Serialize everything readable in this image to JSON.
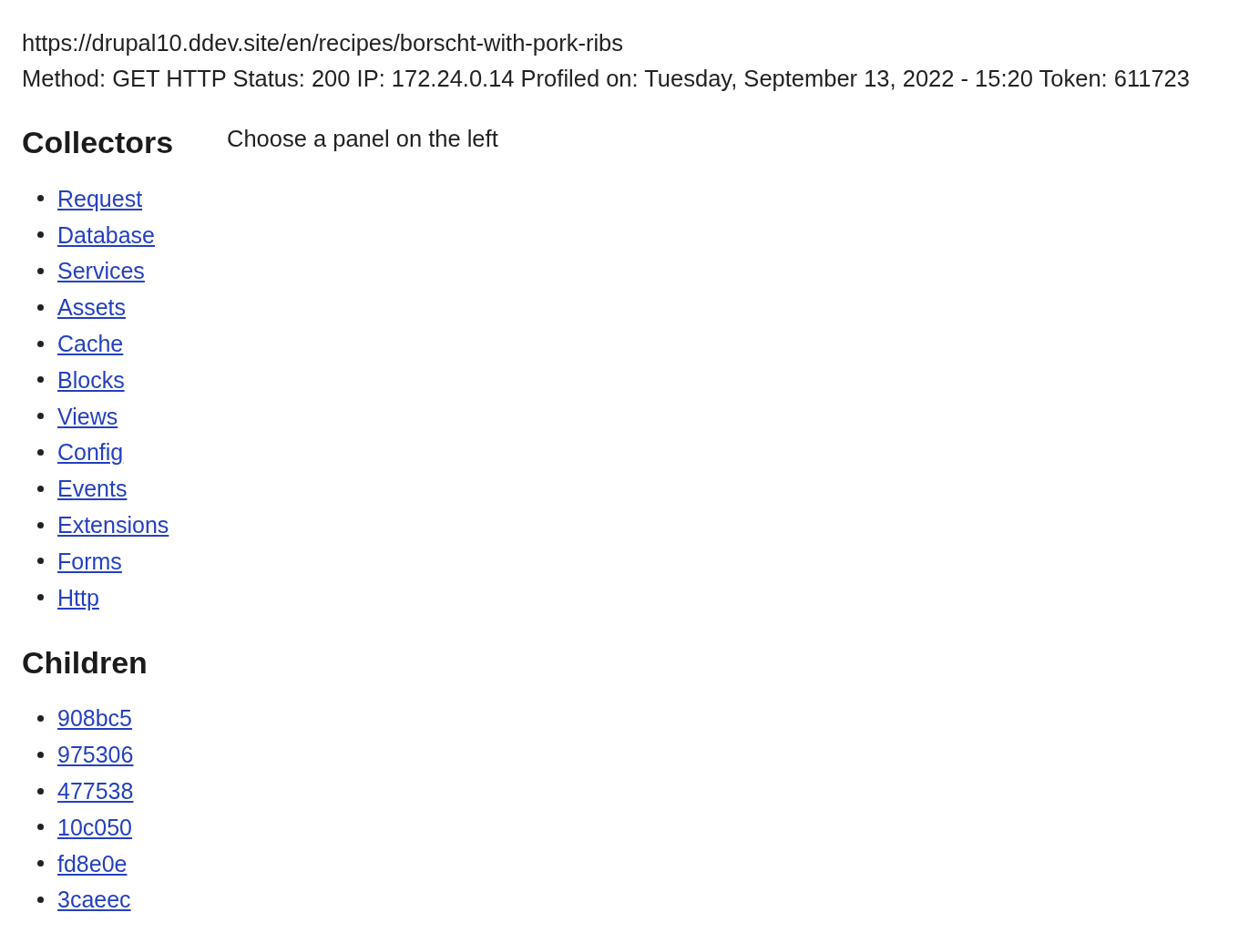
{
  "request": {
    "url": "https://drupal10.ddev.site/en/recipes/borscht-with-pork-ribs",
    "summary": "Method: GET HTTP Status: 200 IP: 172.24.0.14 Profiled on: Tuesday, September 13, 2022 - 15:20 Token: 611723"
  },
  "sidebar": {
    "collectors_heading": "Collectors",
    "collectors": [
      {
        "label": "Request"
      },
      {
        "label": "Database"
      },
      {
        "label": "Services"
      },
      {
        "label": "Assets"
      },
      {
        "label": "Cache"
      },
      {
        "label": "Blocks"
      },
      {
        "label": "Views"
      },
      {
        "label": "Config"
      },
      {
        "label": "Events"
      },
      {
        "label": "Extensions"
      },
      {
        "label": "Forms"
      },
      {
        "label": "Http"
      }
    ],
    "children_heading": "Children",
    "children": [
      {
        "label": "908bc5"
      },
      {
        "label": "975306"
      },
      {
        "label": "477538"
      },
      {
        "label": "10c050"
      },
      {
        "label": "fd8e0e"
      },
      {
        "label": "3caeec"
      }
    ]
  },
  "panel": {
    "message": "Choose a panel on the left"
  }
}
